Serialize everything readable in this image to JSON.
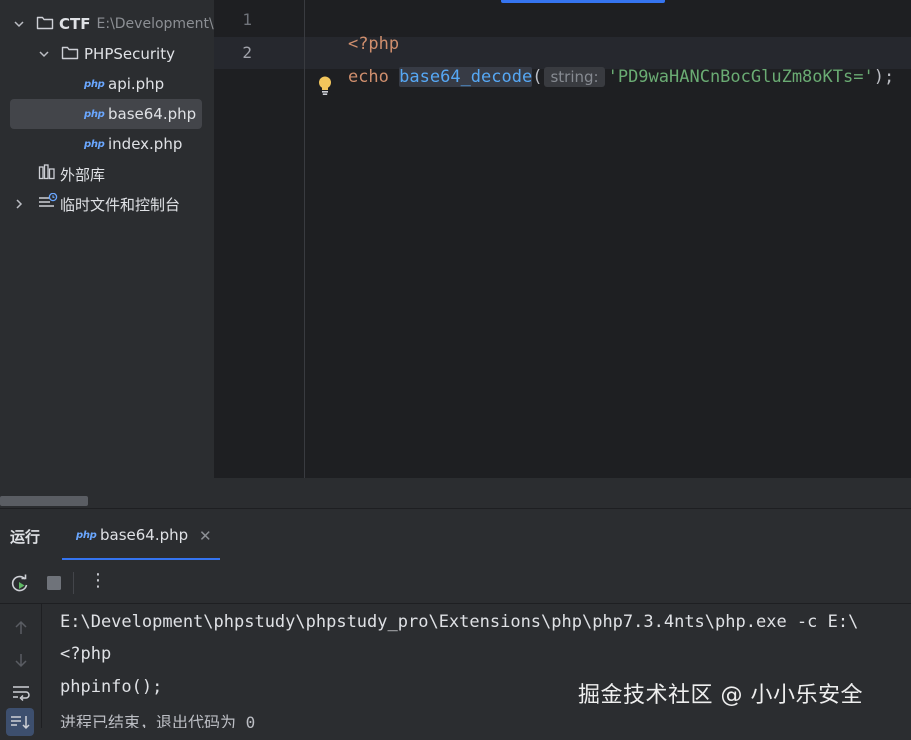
{
  "project_tree": {
    "root": {
      "name": "CTF",
      "path": "E:\\Development\\"
    },
    "folder": {
      "name": "PHPSecurity"
    },
    "files": [
      {
        "icon": "php",
        "name": "api.php"
      },
      {
        "icon": "php",
        "name": "base64.php",
        "selected": true
      },
      {
        "icon": "php",
        "name": "index.php"
      }
    ],
    "external_libraries": "外部库",
    "scratches": "临时文件和控制台"
  },
  "editor": {
    "lines": [
      {
        "number": "1",
        "open_tag": "<?php"
      },
      {
        "number": "2",
        "keyword": "echo",
        "function": "base64_decode",
        "open_paren": "(",
        "param_hint": "string:",
        "string_literal": "'PD9waHANCnBocGluZm8oKTs='",
        "close": ");"
      }
    ]
  },
  "run_panel": {
    "title": "运行",
    "tab_icon": "php",
    "tab_label": "base64.php",
    "tab_close": "✕",
    "toolbar": {
      "rerun": "rerun-icon",
      "stop": "stop-icon",
      "more": "⋮"
    },
    "console": {
      "command": "E:\\Development\\phpstudy\\phpstudy_pro\\Extensions\\php\\php7.3.4nts\\php.exe -c E:\\",
      "output": [
        "<?php",
        "phpinfo();"
      ],
      "exit_message": "进程已结束，退出代码为 0"
    }
  },
  "watermark": "掘金技术社区 @ 小小乐安全",
  "colors": {
    "accent": "#3574f0",
    "editor_bg": "#1e1f22",
    "panel_bg": "#2b2d30",
    "keyword": "#cf8e6d",
    "function": "#56a8f5",
    "string": "#6aab73"
  }
}
